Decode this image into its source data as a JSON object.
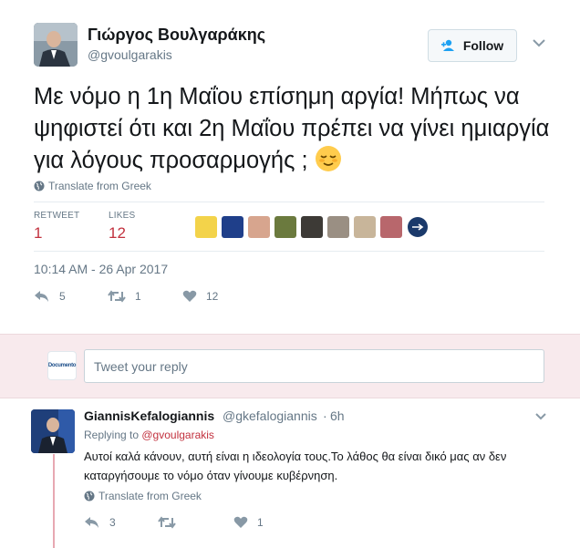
{
  "tweet": {
    "author": {
      "name": "Γιώργος Βουλγαράκης",
      "handle": "@gvoulgarakis"
    },
    "follow_label": "Follow",
    "text": "Με νόμο η 1η Μαΐου  επίσημη αργία! Μήπως να ψηφιστεί ότι και 2η Μαΐου πρέπει να γίνει ημιαργία για  λόγους  προσαρμογής ;",
    "emoji": "relieved-face-emoji",
    "translate_label": "Translate from Greek",
    "stats": {
      "retweets_label": "RETWEET",
      "retweets_value": "1",
      "likes_label": "LIKES",
      "likes_value": "12"
    },
    "likers_count_shown": 9,
    "timestamp": "10:14 AM - 26 Apr 2017",
    "actions": {
      "reply_count": "5",
      "retweet_count": "1",
      "like_count": "12"
    }
  },
  "reply_box": {
    "avatar_text": "Documento",
    "placeholder": "Tweet your reply"
  },
  "reply": {
    "author_name": "GiannisKefalogiannis",
    "author_handle": "@gkefalogiannis",
    "dot": "·",
    "time": "6h",
    "replying_prefix": "Replying to ",
    "replying_mention": "@gvoulgarakis",
    "text": "Αυτοί καλά κάνουν, αυτή είναι η ιδεολογία τους.Το λάθος θα είναι δικό μας αν δεν καταργήσουμε το νόμο όταν γίνουμε κυβέρνηση.",
    "translate_label": "Translate from Greek",
    "actions": {
      "reply_count": "3",
      "retweet_count": "",
      "like_count": "1"
    }
  },
  "colors": {
    "accent_red": "#c2313e",
    "muted_text": "#657786",
    "reply_bar_bg": "#f8eaed",
    "thread_line": "#e7a8b2"
  }
}
